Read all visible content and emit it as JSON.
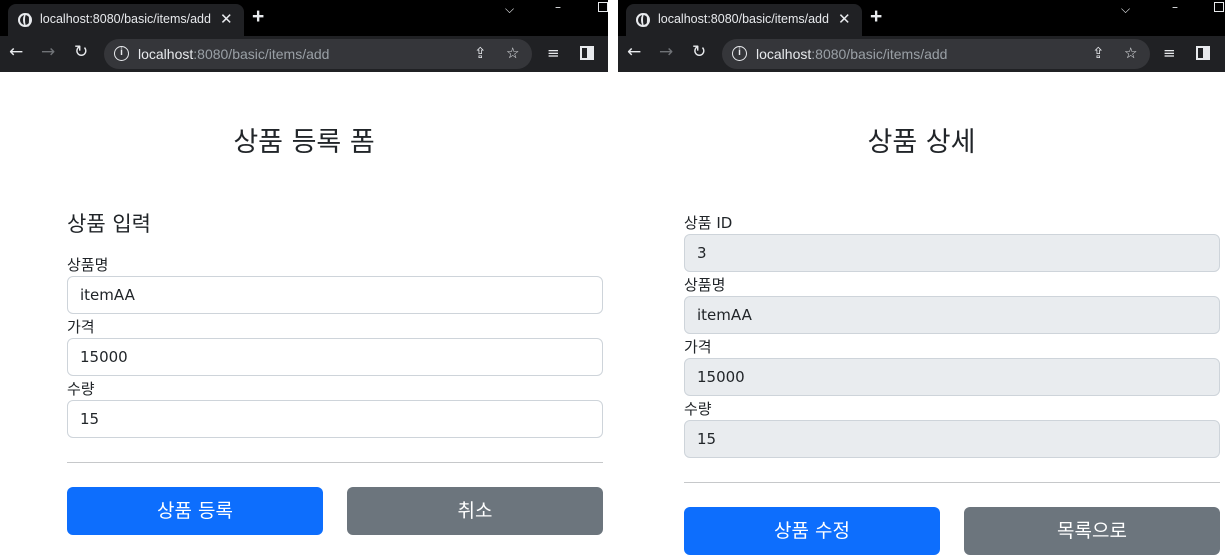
{
  "left_window": {
    "tab": {
      "title": "localhost:8080/basic/items/add",
      "close": "✕",
      "new_tab": "+"
    },
    "address": {
      "host": "localhost",
      "rest": ":8080/basic/items/add"
    },
    "page": {
      "title": "상품 등록 폼",
      "section": "상품 입력",
      "fields": [
        {
          "label": "상품명",
          "value": "itemAA"
        },
        {
          "label": "가격",
          "value": "15000"
        },
        {
          "label": "수량",
          "value": "15"
        }
      ],
      "buttons": {
        "submit": "상품 등록",
        "cancel": "취소"
      }
    }
  },
  "right_window": {
    "tab": {
      "title": "localhost:8080/basic/items/add",
      "close": "✕",
      "new_tab": "+"
    },
    "address": {
      "host": "localhost",
      "rest": ":8080/basic/items/add"
    },
    "page": {
      "title": "상품 상세",
      "fields": [
        {
          "label": "상품 ID",
          "value": "3"
        },
        {
          "label": "상품명",
          "value": "itemAA"
        },
        {
          "label": "가격",
          "value": "15000"
        },
        {
          "label": "수량",
          "value": "15"
        }
      ],
      "buttons": {
        "edit": "상품 수정",
        "list": "목록으로"
      }
    }
  },
  "icons": [
    "globe-icon",
    "close-icon",
    "plus-icon",
    "back-icon",
    "forward-icon",
    "reload-icon",
    "info-icon",
    "share-icon",
    "star-icon",
    "reading-list-icon",
    "side-panel-icon",
    "chevron-down-icon",
    "minimize-icon",
    "maximize-icon"
  ],
  "colors": {
    "primary": "#0d6efd",
    "secondary": "#6c757d",
    "readonly_bg": "#e9ecef",
    "chrome_dark": "#202124"
  }
}
